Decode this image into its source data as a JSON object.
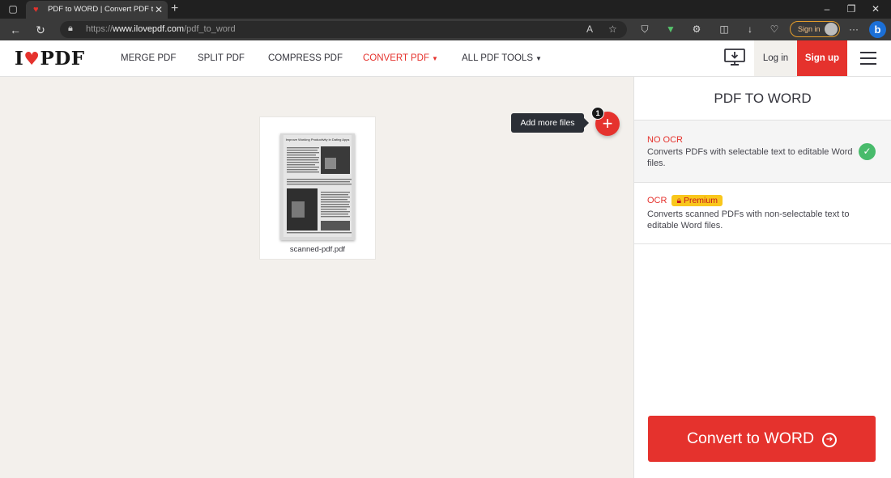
{
  "browser": {
    "tab_title": "PDF to WORD | Convert PDF to W",
    "url_prefix": "https://",
    "url_host": "www.ilovepdf.com",
    "url_path": "/pdf_to_word",
    "signin_label": "Sign in"
  },
  "site": {
    "logo_left": "I",
    "logo_right": "PDF",
    "nav": [
      {
        "label": "MERGE PDF"
      },
      {
        "label": "SPLIT PDF"
      },
      {
        "label": "COMPRESS PDF"
      },
      {
        "label": "CONVERT PDF"
      },
      {
        "label": "ALL PDF TOOLS"
      }
    ],
    "login_label": "Log in",
    "signup_label": "Sign up",
    "brand_color": "#e5322d"
  },
  "workarea": {
    "file_name": "scanned-pdf.pdf",
    "thumb_heading": "Improve Working Productivity in Dating Apps",
    "tooltip": "Add more files",
    "file_count": "1"
  },
  "sidebar": {
    "title": "PDF TO WORD",
    "options": [
      {
        "title": "NO OCR",
        "desc": "Converts PDFs with selectable text to editable Word files.",
        "selected": true
      },
      {
        "title": "OCR",
        "badge": "Premium",
        "desc": "Converts scanned PDFs with non-selectable text to editable Word files.",
        "selected": false
      }
    ],
    "convert_label": "Convert to WORD"
  }
}
